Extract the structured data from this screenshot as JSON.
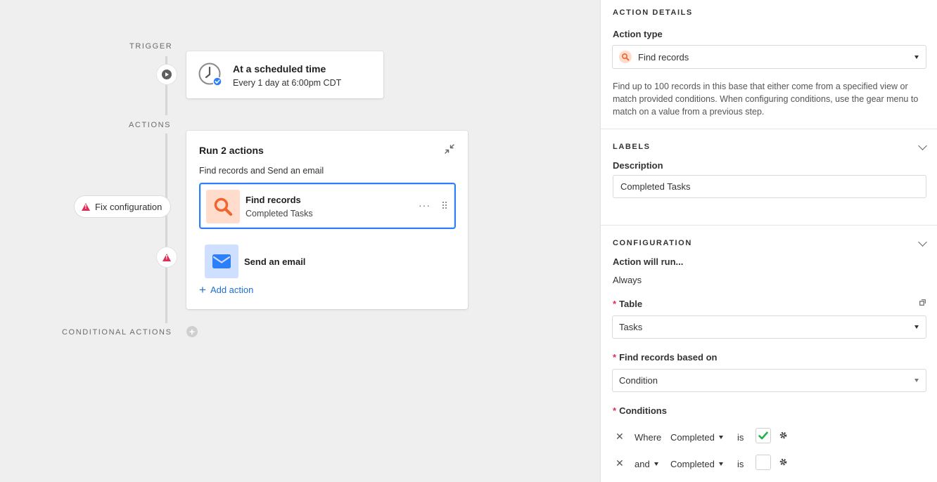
{
  "canvas": {
    "trigger_label": "TRIGGER",
    "actions_label": "ACTIONS",
    "conditional_label": "CONDITIONAL ACTIONS",
    "trigger": {
      "title": "At a scheduled time",
      "subtitle": "Every 1 day at 6:00pm CDT"
    },
    "fix_configuration": "Fix configuration",
    "actions_group": {
      "title": "Run 2 actions",
      "subtitle": "Find records and Send an email",
      "steps": [
        {
          "title": "Find records",
          "subtitle": "Completed Tasks",
          "more": "···"
        },
        {
          "title": "Send an email"
        }
      ],
      "add_action": "Add action"
    }
  },
  "panel": {
    "action_details": {
      "heading": "ACTION DETAILS",
      "action_type_label": "Action type",
      "action_type_value": "Find records",
      "description": "Find up to 100 records in this base that either come from a specified view or match provided conditions. When configuring conditions, use the gear menu to match on a value from a previous step."
    },
    "labels": {
      "heading": "LABELS",
      "description_label": "Description",
      "description_value": "Completed Tasks"
    },
    "configuration": {
      "heading": "CONFIGURATION",
      "will_run_label": "Action will run...",
      "will_run_value": "Always",
      "table_label": "Table",
      "table_value": "Tasks",
      "based_on_label": "Find records based on",
      "based_on_value": "Condition",
      "conditions_label": "Conditions",
      "conditions": [
        {
          "remove": "✕",
          "prefix": "Where",
          "field": "Completed",
          "operator": "is",
          "checked": true
        },
        {
          "remove": "✕",
          "prefix": "and",
          "field": "Completed",
          "operator": "is",
          "checked": false
        }
      ]
    }
  },
  "colors": {
    "accent_blue": "#2d7ff9",
    "link_blue": "#1f6fcf",
    "warning_red": "#e02d55",
    "find_orange": "#f0642d",
    "check_green": "#20b54a"
  }
}
